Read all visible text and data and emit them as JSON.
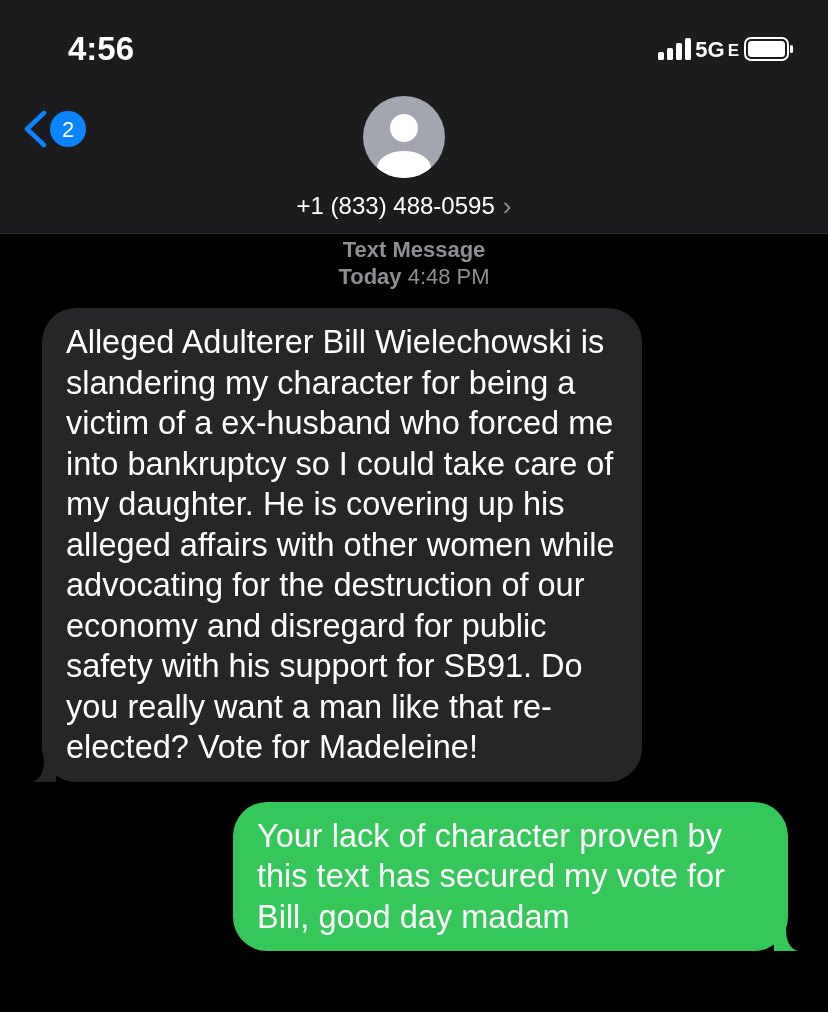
{
  "status_bar": {
    "time": "4:56",
    "network": "5G",
    "network_sub": "E"
  },
  "header": {
    "back_badge": "2",
    "contact": "+1 (833) 488-0595",
    "contact_chevron": "›"
  },
  "thread_info": {
    "service": "Text Message",
    "timestamp": "**Today** 4:48 PM"
  },
  "messages": [
    {
      "kind": "incoming",
      "text": "Alleged Adulterer Bill Wielechowski is slandering my character for being a victim of a ex-husband who forced me into bankruptcy so I could take care of my daughter. He is covering up his alleged affairs with other women while advocating for the destruction of our economy and disregard for public safety with his support for SB91. Do you really want a man like that re-elected? Vote for Madeleine!"
    },
    {
      "kind": "outgoing",
      "text": "Your lack of character proven by this text has secured my vote for Bill, good day madam"
    }
  ]
}
